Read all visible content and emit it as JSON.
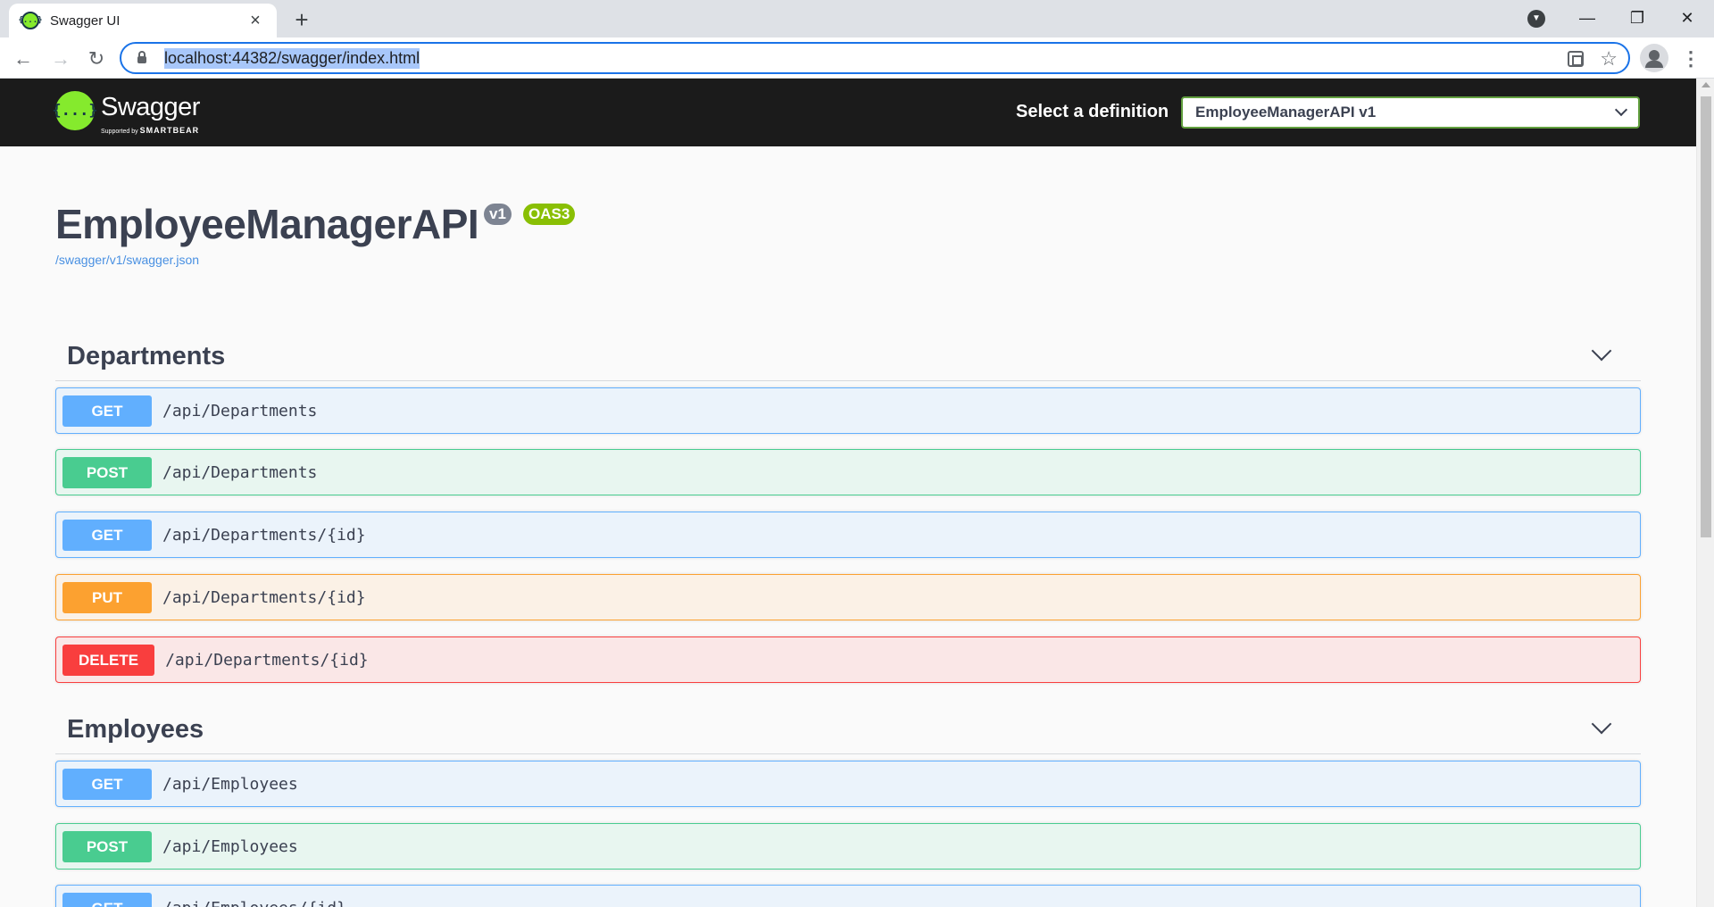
{
  "browser": {
    "tab_title": "Swagger UI",
    "favicon_text": "{...}",
    "url": "localhost:44382/swagger/index.html"
  },
  "topbar": {
    "brand": "Swagger",
    "logo_text": "{...}",
    "supported_by": "Supported by",
    "smartbear": "SMARTBEAR",
    "definition_label": "Select a definition",
    "definition_selected": "EmployeeManagerAPI v1"
  },
  "info": {
    "title": "EmployeeManagerAPI",
    "version_badge": "v1",
    "oas_badge": "OAS3",
    "spec_link": "/swagger/v1/swagger.json"
  },
  "tags": [
    {
      "name": "Departments",
      "operations": [
        {
          "method": "GET",
          "path": "/api/Departments"
        },
        {
          "method": "POST",
          "path": "/api/Departments"
        },
        {
          "method": "GET",
          "path": "/api/Departments/{id}"
        },
        {
          "method": "PUT",
          "path": "/api/Departments/{id}"
        },
        {
          "method": "DELETE",
          "path": "/api/Departments/{id}"
        }
      ]
    },
    {
      "name": "Employees",
      "operations": [
        {
          "method": "GET",
          "path": "/api/Employees"
        },
        {
          "method": "POST",
          "path": "/api/Employees"
        },
        {
          "method": "GET",
          "path": "/api/Employees/{id}"
        }
      ]
    }
  ],
  "colors": {
    "get": "#61affe",
    "post": "#49cc90",
    "put": "#fca130",
    "delete": "#f93e3e",
    "brand_green": "#85ea2d"
  }
}
